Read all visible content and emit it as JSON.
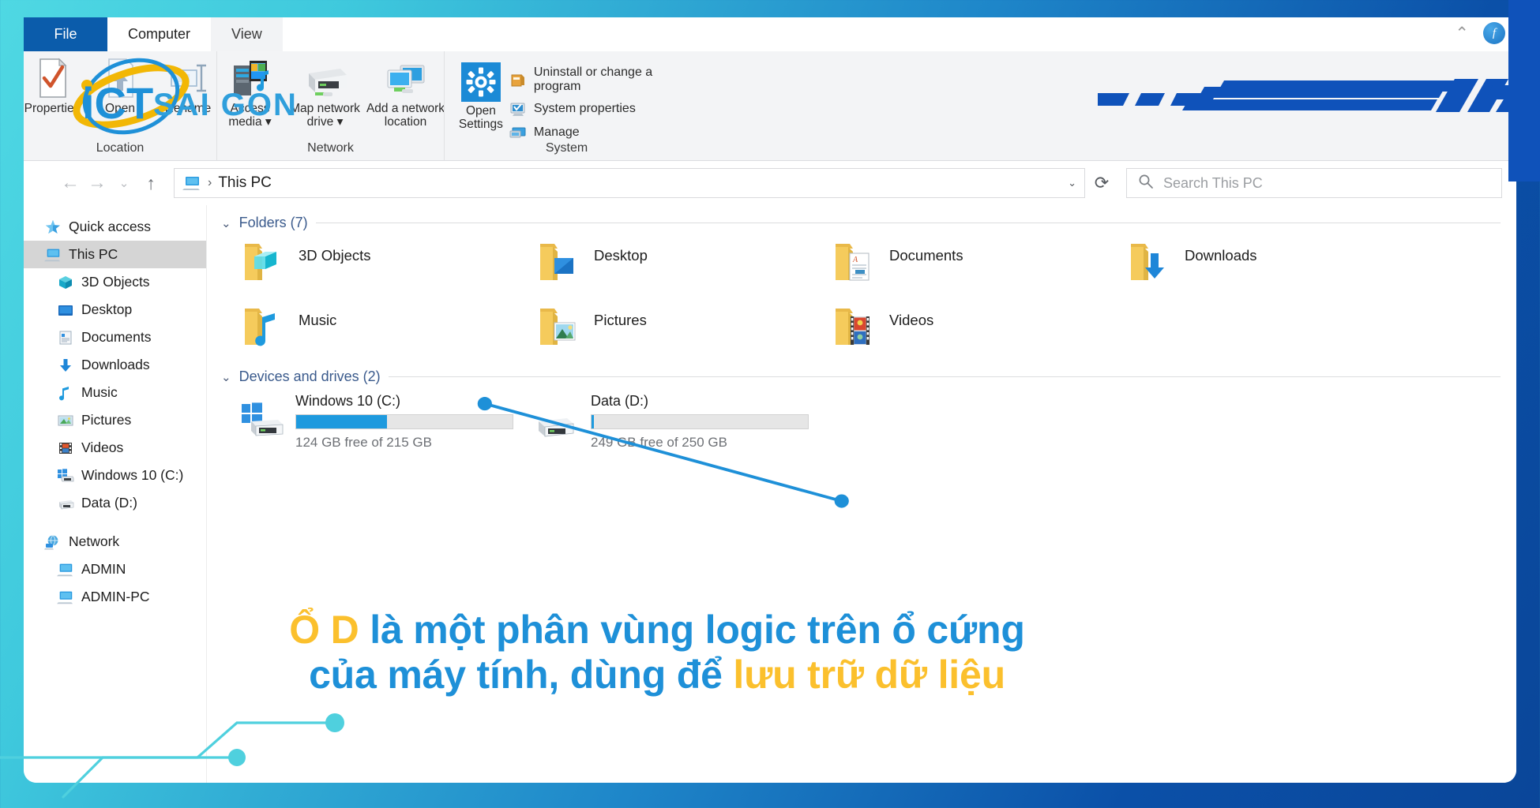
{
  "window": {
    "controls": {
      "collapse_ribbon": "chevron-up",
      "help": "?"
    },
    "tabs": [
      {
        "label": "File",
        "state": "file"
      },
      {
        "label": "Computer",
        "state": "active"
      },
      {
        "label": "View",
        "state": "inactive"
      }
    ]
  },
  "ribbon": {
    "groups": [
      {
        "label": "Location",
        "buttons": [
          {
            "label": "Properties",
            "icon": "properties-icon"
          },
          {
            "label": "Open",
            "icon": "open-icon"
          },
          {
            "label": "Rename",
            "icon": "rename-icon"
          }
        ]
      },
      {
        "label": "Network",
        "buttons": [
          {
            "label": "Access media",
            "icon": "access-media-icon",
            "dropdown": true
          },
          {
            "label": "Map network drive",
            "icon": "map-network-drive-icon",
            "dropdown": true
          },
          {
            "label": "Add a network location",
            "icon": "add-network-location-icon",
            "dropdown": false
          }
        ]
      },
      {
        "label": "System",
        "big_button": {
          "label": "Open Settings",
          "icon": "gear-icon"
        },
        "items": [
          {
            "label": "Uninstall or change a program",
            "icon": "uninstall-program-icon"
          },
          {
            "label": "System properties",
            "icon": "system-properties-icon"
          },
          {
            "label": "Manage",
            "icon": "manage-icon"
          }
        ]
      }
    ]
  },
  "addressbar": {
    "back": "←",
    "forward": "→",
    "history": "⌄",
    "up": "↑",
    "breadcrumb_icon": "this-pc-icon",
    "breadcrumb_separator": "›",
    "breadcrumb": "This PC",
    "dropdown_caret": "⌄",
    "refresh": "⟳",
    "search_placeholder": "Search This PC",
    "search_value": ""
  },
  "sidebar": {
    "items": [
      {
        "label": "Quick access",
        "icon": "star-pin-icon",
        "indent": false,
        "selected": false
      },
      {
        "label": "This PC",
        "icon": "this-pc-icon",
        "indent": false,
        "selected": true
      },
      {
        "label": "3D Objects",
        "icon": "3d-objects-icon",
        "indent": true,
        "selected": false
      },
      {
        "label": "Desktop",
        "icon": "desktop-icon",
        "indent": true,
        "selected": false
      },
      {
        "label": "Documents",
        "icon": "documents-icon",
        "indent": true,
        "selected": false
      },
      {
        "label": "Downloads",
        "icon": "downloads-icon",
        "indent": true,
        "selected": false
      },
      {
        "label": "Music",
        "icon": "music-icon",
        "indent": true,
        "selected": false
      },
      {
        "label": "Pictures",
        "icon": "pictures-icon",
        "indent": true,
        "selected": false
      },
      {
        "label": "Videos",
        "icon": "videos-icon",
        "indent": true,
        "selected": false
      },
      {
        "label": "Windows 10 (C:)",
        "icon": "windows-drive-icon",
        "indent": true,
        "selected": false
      },
      {
        "label": "Data (D:)",
        "icon": "drive-icon",
        "indent": true,
        "selected": false
      },
      {
        "label": "Network",
        "icon": "network-icon",
        "indent": false,
        "selected": false,
        "spacer_before": true
      },
      {
        "label": "ADMIN",
        "icon": "computer-icon",
        "indent": true,
        "selected": false
      },
      {
        "label": "ADMIN-PC",
        "icon": "computer-icon",
        "indent": true,
        "selected": false
      }
    ]
  },
  "content": {
    "folders_group": {
      "chevron": "⌄",
      "title": "Folders (7)"
    },
    "folders": [
      {
        "name": "3D Objects",
        "icon": "folder-3d-objects-icon"
      },
      {
        "name": "Desktop",
        "icon": "folder-desktop-icon"
      },
      {
        "name": "Documents",
        "icon": "folder-documents-icon"
      },
      {
        "name": "Downloads",
        "icon": "folder-downloads-icon"
      },
      {
        "name": "Music",
        "icon": "folder-music-icon"
      },
      {
        "name": "Pictures",
        "icon": "folder-pictures-icon"
      },
      {
        "name": "Videos",
        "icon": "folder-videos-icon"
      }
    ],
    "drives_group": {
      "chevron": "⌄",
      "title": "Devices and drives (2)"
    },
    "drives": [
      {
        "name": "Windows 10 (C:)",
        "icon": "windows-drive-icon",
        "free_text": "124 GB free of 215 GB",
        "used_percent": 42,
        "bar_color": "#1e9ade"
      },
      {
        "name": "Data (D:)",
        "icon": "drive-icon",
        "free_text": "249 GB free of 250 GB",
        "used_percent": 1,
        "bar_color": "#1e9ade"
      }
    ]
  },
  "annotation": {
    "line_color": "#1e90d8",
    "caption_line1_highlight": "Ổ D",
    "caption_line1_rest": " là một phân vùng logic trên ổ cứng",
    "caption_line2_rest": "của máy tính, dùng để ",
    "caption_line2_highlight": "lưu trữ dữ liệu",
    "colors": {
      "blue": "#1e90d8",
      "yellow": "#fbc02d"
    }
  },
  "watermark": {
    "text_primary": "iCT",
    "text_secondary": "SAI GON"
  },
  "theme": {
    "bg_cyan": "#4fd8e3",
    "bg_blue": "#0a4699",
    "tab_file_bg": "#0b5cab",
    "accent": "#1e9ade",
    "deco_line": "#4fd0de",
    "stripe_blue": "#0f52ba"
  }
}
